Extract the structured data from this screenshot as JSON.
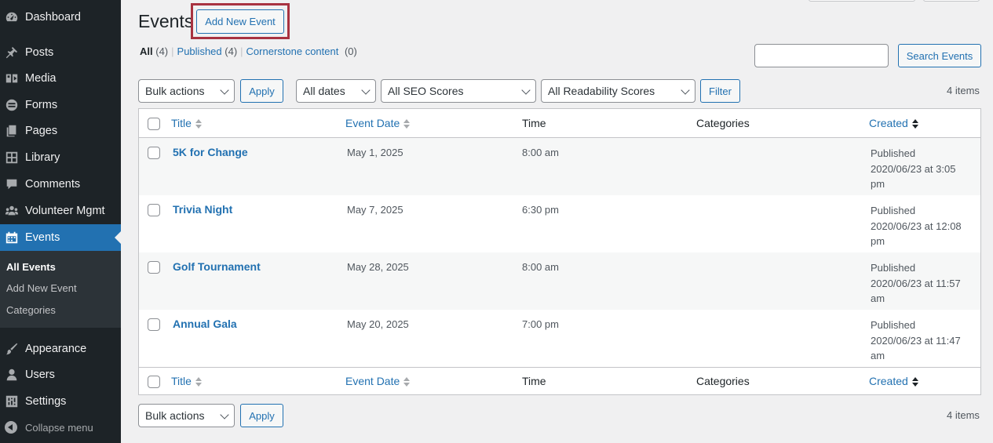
{
  "sidebar": {
    "items": [
      {
        "label": "Dashboard",
        "icon": "dashboard-icon"
      },
      {
        "label": "Posts",
        "icon": "pin-icon"
      },
      {
        "label": "Media",
        "icon": "media-icon"
      },
      {
        "label": "Forms",
        "icon": "forms-icon"
      },
      {
        "label": "Pages",
        "icon": "pages-icon"
      },
      {
        "label": "Library",
        "icon": "library-icon"
      },
      {
        "label": "Comments",
        "icon": "comment-icon"
      },
      {
        "label": "Volunteer Mgmt",
        "icon": "groups-icon"
      },
      {
        "label": "Events",
        "icon": "calendar-icon"
      },
      {
        "label": "Appearance",
        "icon": "brush-icon"
      },
      {
        "label": "Users",
        "icon": "user-icon"
      },
      {
        "label": "Settings",
        "icon": "settings-icon"
      }
    ],
    "submenu": [
      "All Events",
      "Add New Event",
      "Categories"
    ],
    "collapse_label": "Collapse menu"
  },
  "header": {
    "title": "Events",
    "add_new_label": "Add New Event"
  },
  "filters_links": {
    "all": {
      "label": "All",
      "count": "(4)"
    },
    "published": {
      "label": "Published",
      "count": "(4)"
    },
    "cornerstone": {
      "label": "Cornerstone content",
      "count": "(0)"
    },
    "separator": "|"
  },
  "search": {
    "value": "",
    "button_label": "Search Events"
  },
  "toolbar": {
    "bulk_actions": "Bulk actions",
    "apply": "Apply",
    "dates": "All dates",
    "seo": "All SEO Scores",
    "readability": "All Readability Scores",
    "filter": "Filter",
    "items_count": "4 items"
  },
  "table": {
    "columns": {
      "title": "Title",
      "event_date": "Event Date",
      "time": "Time",
      "categories": "Categories",
      "created": "Created"
    },
    "rows": [
      {
        "title": "5K for Change",
        "event_date": "May 1, 2025",
        "time": "8:00 am",
        "categories": "",
        "status": "Published",
        "created_line1": "2020/06/23 at 3:05",
        "created_line2": "pm"
      },
      {
        "title": "Trivia Night",
        "event_date": "May 7, 2025",
        "time": "6:30 pm",
        "categories": "",
        "status": "Published",
        "created_line1": "2020/06/23 at 12:08",
        "created_line2": "pm"
      },
      {
        "title": "Golf Tournament",
        "event_date": "May 28, 2025",
        "time": "8:00 am",
        "categories": "",
        "status": "Published",
        "created_line1": "2020/06/23 at 11:57",
        "created_line2": "am"
      },
      {
        "title": "Annual Gala",
        "event_date": "May 20, 2025",
        "time": "7:00 pm",
        "categories": "",
        "status": "Published",
        "created_line1": "2020/06/23 at 11:47",
        "created_line2": "am"
      }
    ]
  },
  "bottom_toolbar": {
    "bulk_actions": "Bulk actions",
    "apply": "Apply",
    "items_count": "4 items"
  },
  "colors": {
    "sidebar_bg": "#1d2327",
    "accent": "#2271b1",
    "highlight_border": "#a83240"
  }
}
